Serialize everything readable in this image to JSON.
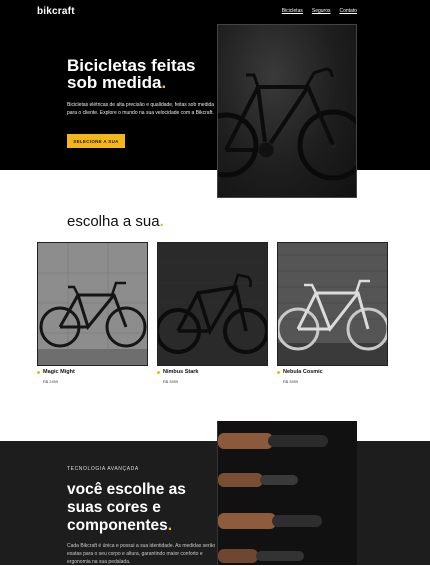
{
  "header": {
    "logo": "bikcraft",
    "nav": [
      "Bicicletas",
      "Seguros",
      "Contato"
    ]
  },
  "hero": {
    "title": "Bicicletas feitas sob medida",
    "title_dot": ".",
    "description": "Bicicletas elétricas de alta precisão e qualidade, feitas sob medida para o cliente. Explore o mundo na sua velocidade com a Bikcraft.",
    "button_label": "SELECIONE A SUA"
  },
  "choose": {
    "title": "escolha a sua",
    "title_dot": ".",
    "products": [
      {
        "name": "Magic Might",
        "price": "R$ 2499"
      },
      {
        "name": "Nimbus Stark",
        "price": "R$ 3999"
      },
      {
        "name": "Nebula Cosmic",
        "price": "R$ 3999"
      }
    ]
  },
  "tech": {
    "kicker": "TECNOLOGIA AVANÇADA",
    "title": "você escolhe as suas cores e componentes",
    "title_dot": ".",
    "description": "Cada Bikcraft é única e possui a sua identidade. As medidas serão exatas para o seu corpo e altura, garantindo maior conforto e ergonomia na sua pedalada."
  },
  "colors": {
    "accent": "#f4b619",
    "dark": "#000000",
    "tech_bg": "#1d1d1d"
  }
}
